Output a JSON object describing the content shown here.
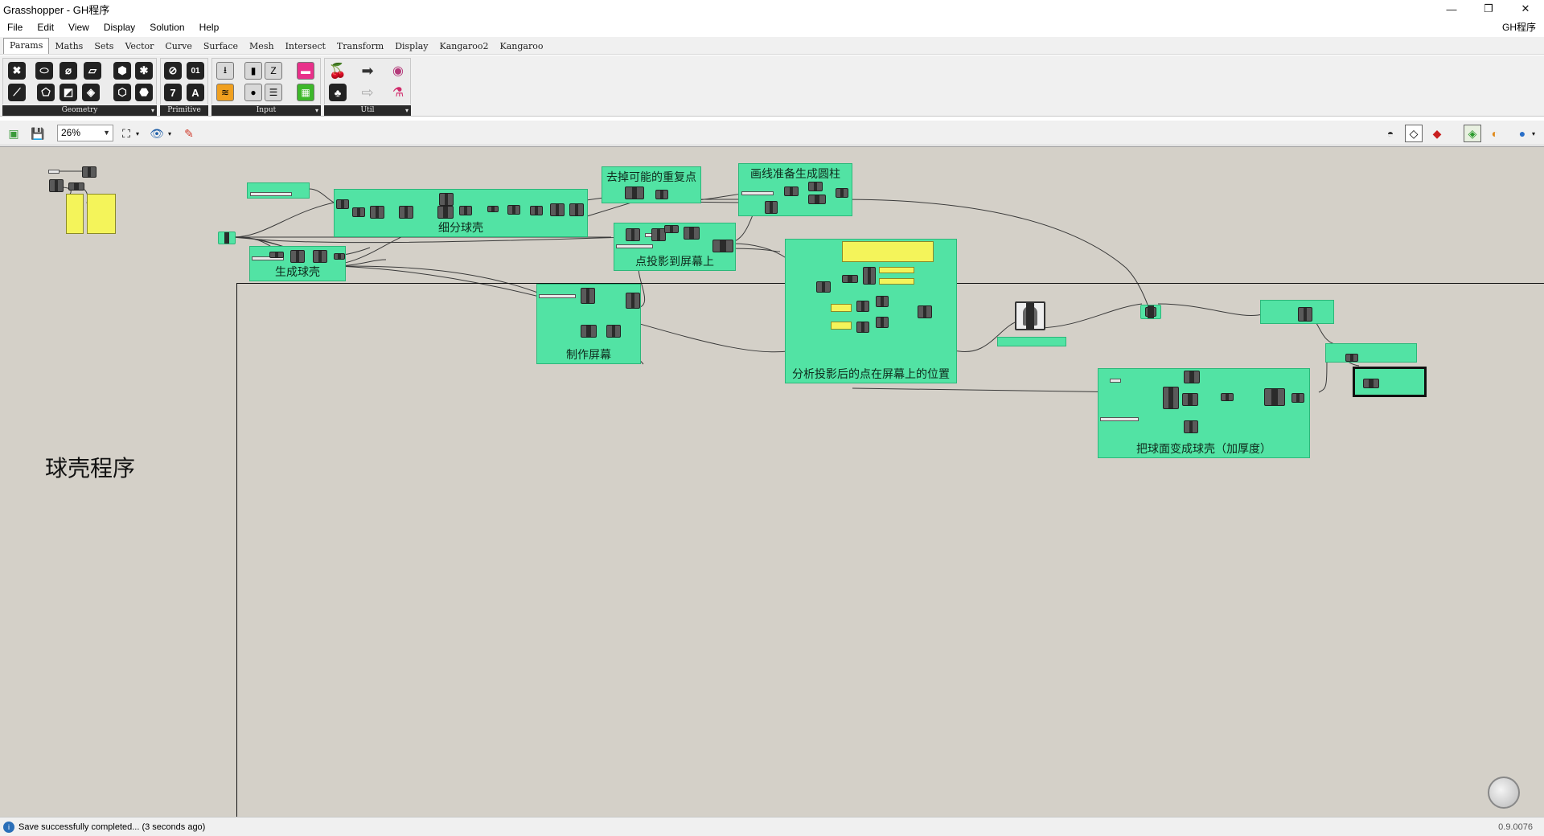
{
  "window": {
    "title": "Grasshopper - GH程序",
    "minimize_glyph": "—",
    "restore_glyph": "❐",
    "close_glyph": "✕"
  },
  "menu": {
    "items": [
      "File",
      "Edit",
      "View",
      "Display",
      "Solution",
      "Help"
    ],
    "document_name": "GH程序"
  },
  "ribbon_tabs": [
    "Params",
    "Maths",
    "Sets",
    "Vector",
    "Curve",
    "Surface",
    "Mesh",
    "Intersect",
    "Transform",
    "Display",
    "Kangaroo2",
    "Kangaroo"
  ],
  "ribbon_panels": {
    "geometry": "Geometry",
    "primitive": "Primitive",
    "input": "Input",
    "util": "Util"
  },
  "primitive_icons": {
    "number": "7",
    "text": "A",
    "integer": "01"
  },
  "canvas_toolbar": {
    "zoom": "26%"
  },
  "canvas": {
    "title": "球壳程序",
    "groups": {
      "subdivide": "细分球壳",
      "dedupe": "去掉可能的重复点",
      "lines": "画线准备生成圆柱",
      "shell": "生成球壳",
      "project": "点投影到屏幕上",
      "screen": "制作屏幕",
      "analyze": "分析投影后的点在屏幕上的位置",
      "thicken": "把球面变成球壳（加厚度）"
    }
  },
  "status": {
    "message": "Save successfully completed... (3 seconds ago)",
    "version": "0.9.0076"
  }
}
